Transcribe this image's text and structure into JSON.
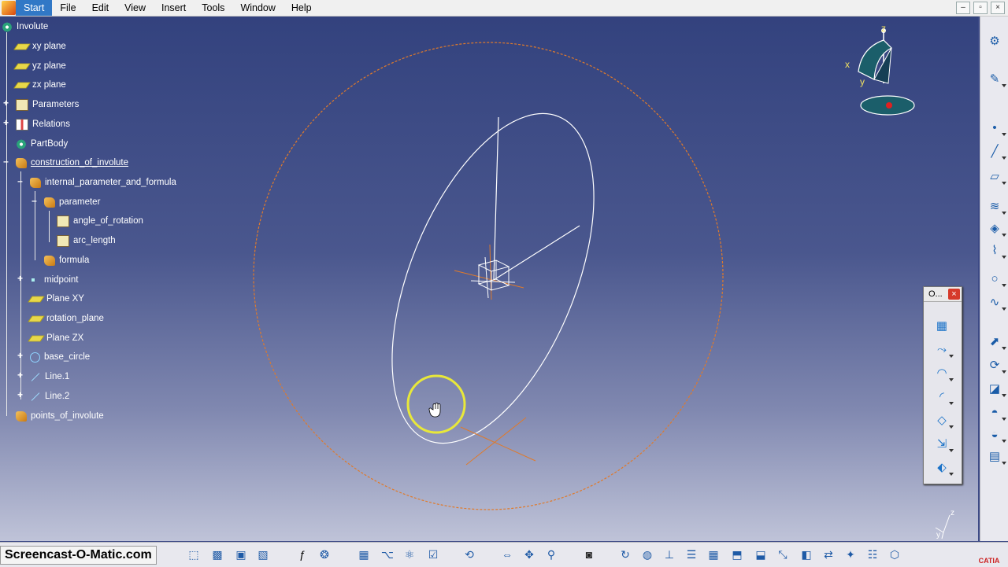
{
  "menu": {
    "items": [
      "Start",
      "File",
      "Edit",
      "View",
      "Insert",
      "Tools",
      "Window",
      "Help"
    ],
    "active": "Start",
    "window_controls": [
      "–",
      "▫",
      "×"
    ]
  },
  "tree": {
    "root": "Involute",
    "items": [
      {
        "label": "xy plane",
        "icon": "plane-icon"
      },
      {
        "label": "yz plane",
        "icon": "plane-icon"
      },
      {
        "label": "zx plane",
        "icon": "plane-icon"
      },
      {
        "label": "Parameters",
        "icon": "param-icon"
      },
      {
        "label": "Relations",
        "icon": "rel-icon"
      },
      {
        "label": "PartBody",
        "icon": "gear-icon"
      },
      {
        "label": "construction_of_involute",
        "icon": "hand-icon"
      },
      {
        "label": "internal_parameter_and_formula",
        "icon": "hand-icon"
      },
      {
        "label": "parameter",
        "icon": "hand-icon"
      },
      {
        "label": "angle_of_rotation",
        "icon": "param-icon"
      },
      {
        "label": "arc_length",
        "icon": "param-icon"
      },
      {
        "label": "formula",
        "icon": "hand-icon"
      },
      {
        "label": "midpoint",
        "icon": "point-icon"
      },
      {
        "label": "Plane XY",
        "icon": "plane-icon"
      },
      {
        "label": "rotation_plane",
        "icon": "plane-icon"
      },
      {
        "label": "Plane ZX",
        "icon": "plane-icon"
      },
      {
        "label": "base_circle",
        "icon": "circle-icon"
      },
      {
        "label": "Line.1",
        "icon": "line-icon"
      },
      {
        "label": "Line.2",
        "icon": "line-icon"
      },
      {
        "label": "points_of_involute",
        "icon": "hand-icon"
      }
    ]
  },
  "compass": {
    "x_label": "x",
    "y_label": "y",
    "z_label": "z"
  },
  "mini_axis": {
    "y_label": "y",
    "z_label": "z"
  },
  "palette": {
    "title": "O...",
    "close": "×"
  },
  "watermark": "Screencast-O-Matic.com",
  "catia_logo": "CATIA",
  "colors": {
    "viewport_top": "#33427e",
    "orange_geometry": "#e07a2a",
    "white_geometry": "#ffffff",
    "highlight_ring": "#e8e83a"
  }
}
